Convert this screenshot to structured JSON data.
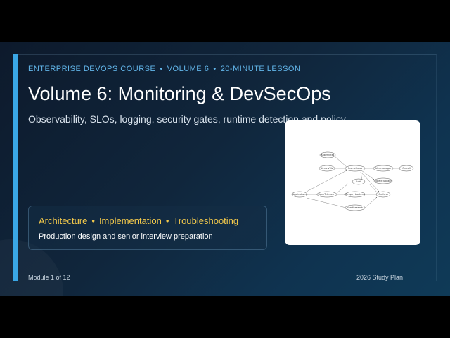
{
  "header": {
    "kicker": [
      "ENTERPRISE DEVOPS COURSE",
      "VOLUME 6",
      "20-MINUTE LESSON"
    ],
    "kicker_separator": "•",
    "title": "Volume 6: Monitoring & DevSecOps",
    "subtitle": "Observability, SLOs, logging, security gates, runtime detection and policy"
  },
  "topics": {
    "items": [
      "Architecture",
      "Implementation",
      "Troubleshooting"
    ],
    "separator": "•",
    "subtitle": "Production design and senior interview preparation"
  },
  "footer": {
    "module": "Module 1 of 12",
    "plan": "2026 Study Plan"
  },
  "diagram": {
    "nodes": [
      {
        "id": "kubernetes",
        "label": "Kubernetes"
      },
      {
        "id": "linuxvms",
        "label": "Linux VMs"
      },
      {
        "id": "prometheus",
        "label": "Prometheus"
      },
      {
        "id": "alertmanager",
        "label": "Alertmanager"
      },
      {
        "id": "oncall",
        "label": "On-call"
      },
      {
        "id": "loki",
        "label": "Loki"
      },
      {
        "id": "objectstorage",
        "label": "Object Storage"
      },
      {
        "id": "applications",
        "label": "Applications"
      },
      {
        "id": "otelcollector",
        "label": "OpenTelemetry"
      },
      {
        "id": "tempo",
        "label": "Tempo / backend"
      },
      {
        "id": "grafana",
        "label": "Grafana"
      },
      {
        "id": "elasticsearch",
        "label": "Elasticsearch"
      }
    ]
  },
  "colors": {
    "accent_bar": "#3aa7e6",
    "kicker": "#62b6ea",
    "topics": "#f2c84b",
    "title": "#ffffff"
  }
}
